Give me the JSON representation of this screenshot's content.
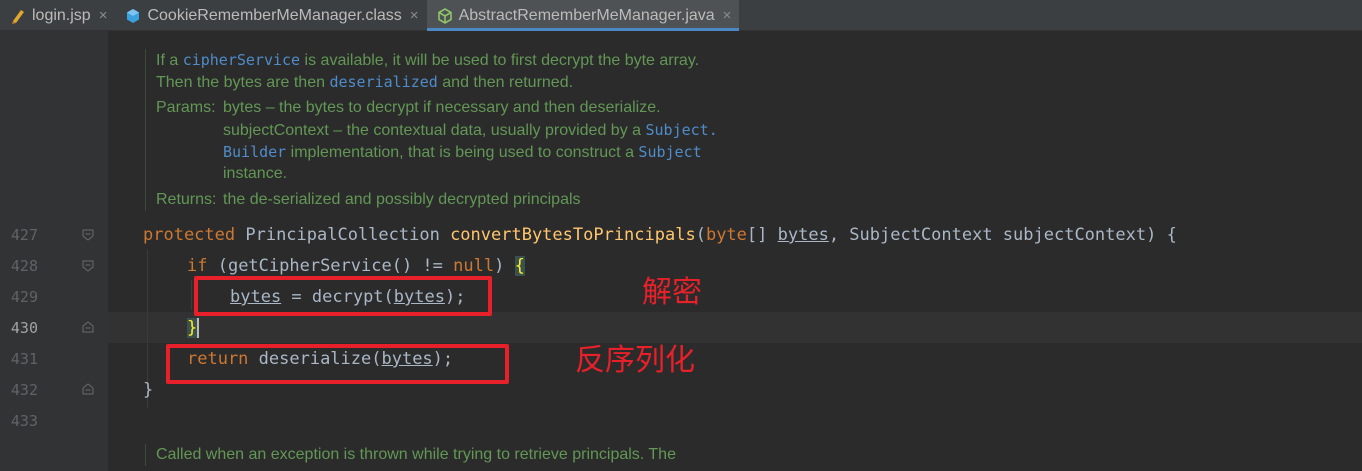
{
  "tabs": [
    {
      "label": "login.jsp",
      "icon": "jsp-file-icon",
      "active": false
    },
    {
      "label": "CookieRememberMeManager.class",
      "icon": "class-file-icon",
      "active": false
    },
    {
      "label": "AbstractRememberMeManager.java",
      "icon": "java-file-icon",
      "active": true
    }
  ],
  "tab_close_glyph": "×",
  "doc_top": {
    "line1_a": "If a ",
    "line1_code": "cipherService",
    "line1_b": " is available, it will be used to first decrypt the byte array.",
    "line2_a": "Then the bytes are then ",
    "line2_code": "deserialized",
    "line2_b": " and then returned.",
    "params_label": "Params:",
    "param1": "bytes – the bytes to decrypt if necessary and then deserialize.",
    "param2_a": "subjectContext – the contextual data, usually provided by a ",
    "param2_code": "Subject.",
    "param3_code": "Builder",
    "param3_a": " implementation, that is being used to construct a ",
    "param3_code2": "Subject",
    "param4": "instance.",
    "returns_label": "Returns:",
    "returns": "the de-serialized and possibly decrypted principals"
  },
  "doc_bottom": {
    "line1": "Called when an exception is thrown while trying to retrieve principals. The"
  },
  "lines": {
    "l427": "427",
    "l428": "428",
    "l429": "429",
    "l430": "430",
    "l431": "431",
    "l432": "432",
    "l433": "433"
  },
  "code": {
    "l427": {
      "kw": "protected",
      "type": " PrincipalCollection ",
      "fn": "convertBytesToPrincipals",
      "p1": "(",
      "kw2": "byte",
      "p2": "[] ",
      "param": "bytes",
      "p3": ", SubjectContext subjectContext) {"
    },
    "l428": {
      "kw": "if",
      "p1": " (getCipherService() != ",
      "kw2": "null",
      "p2": ") ",
      "brace": "{"
    },
    "l429": {
      "param": "bytes",
      "p1": " = decrypt(",
      "param2": "bytes",
      "p2": ");"
    },
    "l430": {
      "brace": "}"
    },
    "l431": {
      "kw": "return",
      "p1": " deserialize(",
      "param": "bytes",
      "p2": ");"
    },
    "l432": {
      "brace": "}"
    }
  },
  "annotations": {
    "decrypt": "解密",
    "deserialize": "反序列化"
  },
  "colors": {
    "annotation": "#e8202a",
    "keyword": "#cc7832",
    "method": "#ffc66d",
    "doc_comment": "#629755"
  }
}
